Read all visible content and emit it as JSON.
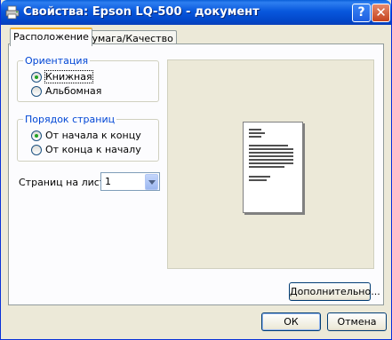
{
  "window": {
    "title": "Свойства: Epson LQ-500 - документ",
    "help_button": "?",
    "close_button": "✕"
  },
  "tabs": [
    {
      "label": "Расположение",
      "active": true
    },
    {
      "label": "Бумага/Качество",
      "active": false
    }
  ],
  "orientation": {
    "group_label": "Ориентация",
    "options": [
      {
        "label": "Книжная",
        "selected": true
      },
      {
        "label": "Альбомная",
        "selected": false
      }
    ]
  },
  "page_order": {
    "group_label": "Порядок страниц",
    "options": [
      {
        "label": "От начала к концу",
        "selected": true
      },
      {
        "label": "От конца к началу",
        "selected": false
      }
    ]
  },
  "pages_per_sheet": {
    "label": "Страниц на листе:",
    "value": "1"
  },
  "buttons": {
    "advanced": "Дополнительно...",
    "ok": "ОК",
    "cancel": "Отмена"
  },
  "colors": {
    "title_bar": "#0a5fd8",
    "group_label": "#0046d5",
    "dialog_bg": "#ece9d8"
  }
}
